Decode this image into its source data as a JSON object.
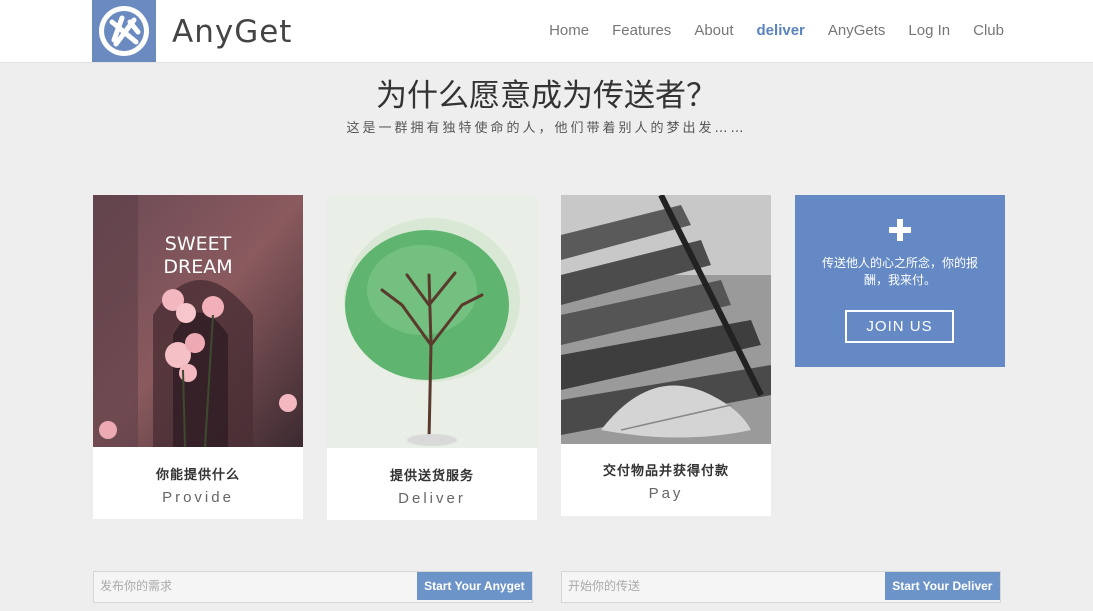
{
  "header": {
    "brand": "AnyGet",
    "nav": [
      {
        "label": "Home"
      },
      {
        "label": "Features"
      },
      {
        "label": "About"
      },
      {
        "label": "deliver",
        "active": true
      },
      {
        "label": "AnyGets"
      },
      {
        "label": "Log In"
      },
      {
        "label": "Club"
      }
    ]
  },
  "hero": {
    "title": "为什么愿意成为传送者？",
    "subtitle": "这是一群拥有独特使命的人，他们带着别人的梦出发……"
  },
  "cards": [
    {
      "title_cn": "你能提供什么",
      "title_en": "Provide",
      "image_text": [
        "SWEET",
        "DREAM"
      ]
    },
    {
      "title_cn": "提供送货服务",
      "title_en": "Deliver"
    },
    {
      "title_cn": "交付物品并获得付款",
      "title_en": "Pay"
    }
  ],
  "join": {
    "icon": "plus-icon",
    "text": "传送他人的心之所念，你的报酬，我来付。",
    "button": "JOIN US"
  },
  "forms": [
    {
      "placeholder": "发布你的需求",
      "button": "Start Your Anyget"
    },
    {
      "placeholder": "开始你的传送",
      "button": "Start Your Deliver"
    }
  ],
  "colors": {
    "accent": "#6489c4",
    "nav_active": "#5b83bf",
    "background": "#eeeeee"
  }
}
